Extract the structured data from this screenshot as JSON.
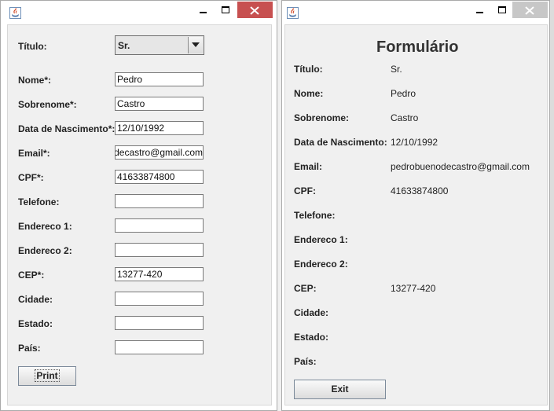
{
  "colors": {
    "close_active": "#c75050",
    "close_inactive": "#c7c7c7",
    "panel_bg": "#f0f0f0"
  },
  "input_window": {
    "icon": "java-cup-icon",
    "controls": {
      "minimize_icon": "minimize-icon",
      "maximize_icon": "maximize-icon",
      "close_icon": "close-icon"
    },
    "titulo_label": "Título:",
    "titulo_value": "Sr.",
    "fields": [
      {
        "label": "Nome*:",
        "value": "Pedro"
      },
      {
        "label": "Sobrenome*:",
        "value": "Castro"
      },
      {
        "label": "Data de Nascimento*:",
        "value": "12/10/1992"
      },
      {
        "label": "Email*:",
        "value": "pedrobuenodecastro@gmail.com"
      },
      {
        "label": "CPF*:",
        "value": "41633874800"
      },
      {
        "label": "Telefone:",
        "value": ""
      },
      {
        "label": "Endereco 1:",
        "value": ""
      },
      {
        "label": "Endereco 2:",
        "value": ""
      },
      {
        "label": "CEP*:",
        "value": "13277-420"
      },
      {
        "label": "Cidade:",
        "value": ""
      },
      {
        "label": "Estado:",
        "value": ""
      },
      {
        "label": "País:",
        "value": ""
      }
    ],
    "print_label": "Print"
  },
  "output_window": {
    "icon": "java-cup-icon",
    "title": "Formulário",
    "rows": [
      {
        "label": "Título:",
        "value": "Sr."
      },
      {
        "label": "Nome:",
        "value": "Pedro"
      },
      {
        "label": "Sobrenome:",
        "value": "Castro"
      },
      {
        "label": "Data de Nascimento:",
        "value": "12/10/1992"
      },
      {
        "label": "Email:",
        "value": "pedrobuenodecastro@gmail.com"
      },
      {
        "label": "CPF:",
        "value": "41633874800"
      },
      {
        "label": "Telefone:",
        "value": ""
      },
      {
        "label": "Endereco 1:",
        "value": ""
      },
      {
        "label": "Endereco 2:",
        "value": ""
      },
      {
        "label": "CEP:",
        "value": "13277-420"
      },
      {
        "label": "Cidade:",
        "value": ""
      },
      {
        "label": "Estado:",
        "value": ""
      },
      {
        "label": "País:",
        "value": ""
      }
    ],
    "exit_label": "Exit"
  }
}
